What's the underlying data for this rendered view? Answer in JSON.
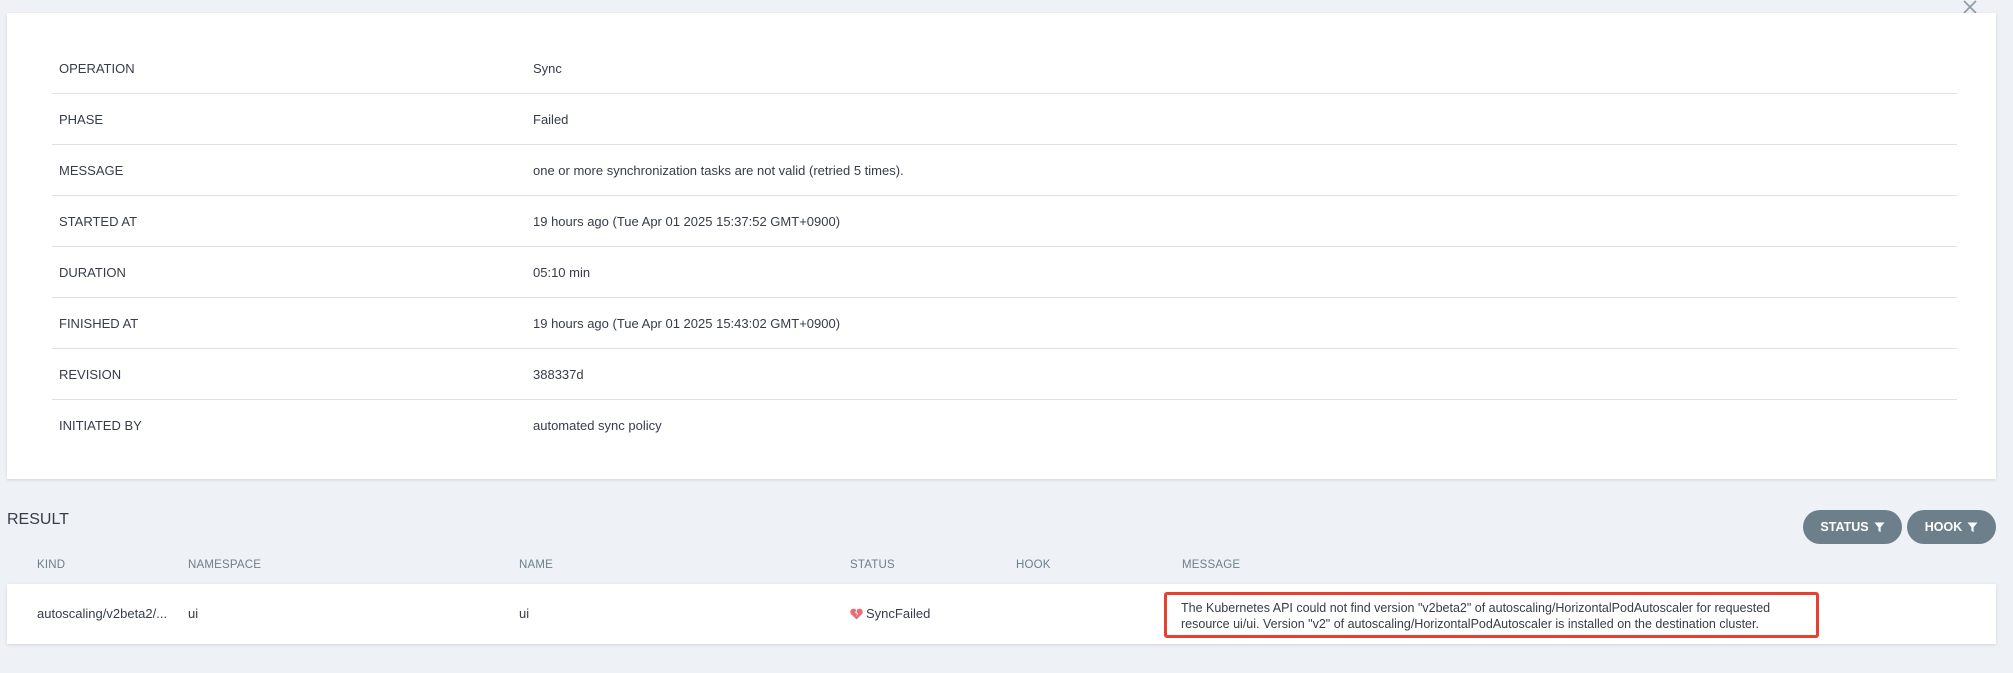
{
  "operation": {
    "rows": [
      {
        "key": "OPERATION",
        "value": "Sync"
      },
      {
        "key": "PHASE",
        "value": "Failed"
      },
      {
        "key": "MESSAGE",
        "value": "one or more synchronization tasks are not valid (retried 5 times)."
      },
      {
        "key": "STARTED AT",
        "value": "19 hours ago (Tue Apr 01 2025 15:37:52 GMT+0900)"
      },
      {
        "key": "DURATION",
        "value": "05:10 min"
      },
      {
        "key": "FINISHED AT",
        "value": "19 hours ago (Tue Apr 01 2025 15:43:02 GMT+0900)"
      },
      {
        "key": "REVISION",
        "value": "388337d"
      },
      {
        "key": "INITIATED BY",
        "value": "automated sync policy"
      }
    ]
  },
  "result": {
    "title": "RESULT",
    "filters": {
      "status": "STATUS",
      "hook": "HOOK"
    },
    "columns": {
      "kind": "KIND",
      "namespace": "NAMESPACE",
      "name": "NAME",
      "status": "STATUS",
      "hook": "HOOK",
      "message": "MESSAGE"
    },
    "rows": [
      {
        "kind": "autoscaling/v2beta2/...",
        "namespace": "ui",
        "name": "ui",
        "status": "SyncFailed",
        "status_icon": "broken-heart-icon",
        "hook": "",
        "message": "The Kubernetes API could not find version \"v2beta2\" of autoscaling/HorizontalPodAutoscaler for requested resource ui/ui. Version \"v2\" of autoscaling/HorizontalPodAutoscaler is installed on the destination cluster."
      }
    ]
  },
  "colors": {
    "background": "#eef1f5",
    "filter_button": "#6d7f8b",
    "highlight_border": "#e8402f",
    "status_failed": "#e96d76"
  }
}
